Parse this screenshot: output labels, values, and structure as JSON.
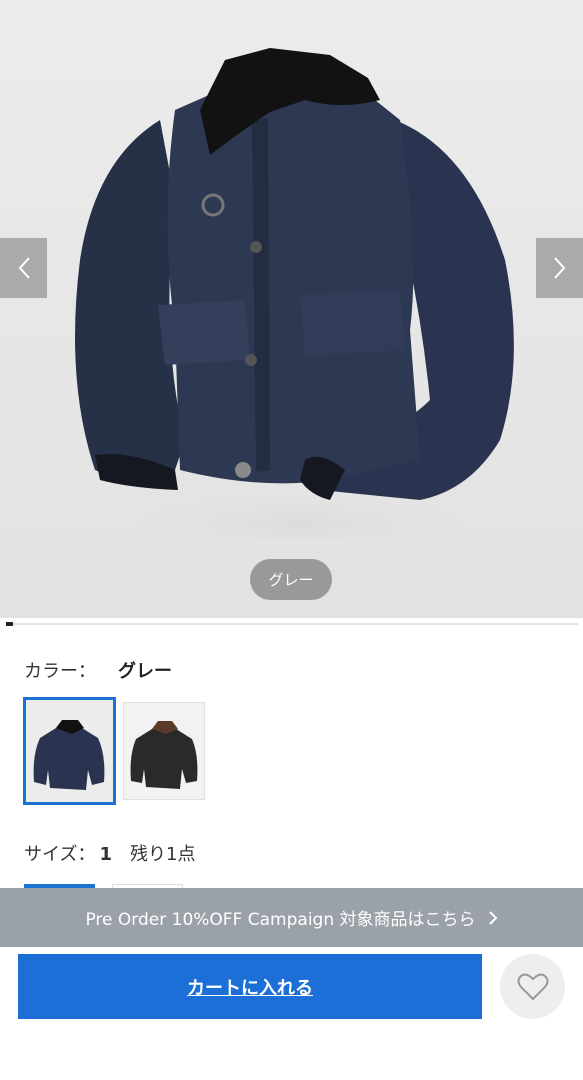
{
  "gallery": {
    "prev_icon": "chevron-left-icon",
    "next_icon": "chevron-right-icon",
    "color_badge": "グレー",
    "progress": 0.01
  },
  "color": {
    "label": "カラー：",
    "value": "グレー",
    "options": [
      "navy-jacket",
      "black-jacket"
    ]
  },
  "size": {
    "label": "サイズ：",
    "value": "1",
    "stock": "残り1点"
  },
  "campaign": {
    "text": "Pre Order 10%OFF Campaign 対象商品はこちら",
    "icon": "chevron-right-icon"
  },
  "actions": {
    "cart_label": "カートに入れる",
    "favorite_icon": "heart-icon"
  },
  "colors": {
    "accent": "#1b6fd6",
    "campaign_bg": "#9aa1a8"
  }
}
